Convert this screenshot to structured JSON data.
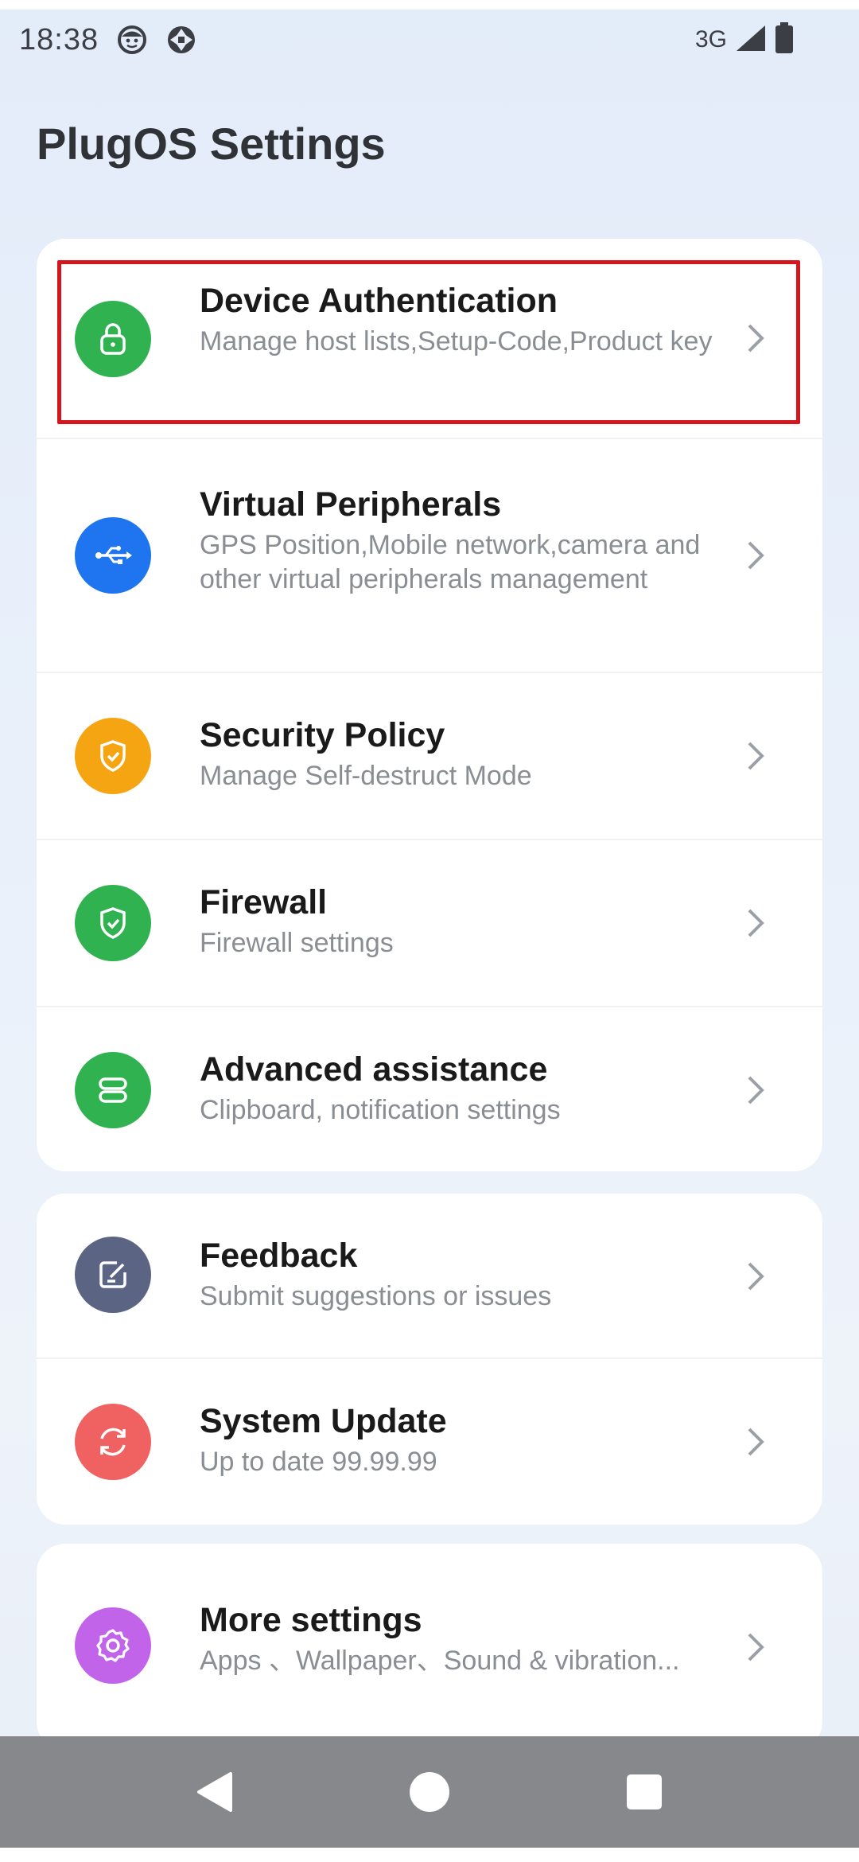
{
  "status_bar": {
    "time": "18:38",
    "network": "3G",
    "icons": [
      "face-notification-icon",
      "sync-notification-icon",
      "signal-icon",
      "battery-icon"
    ]
  },
  "page": {
    "title": "PlugOS Settings"
  },
  "groups": [
    {
      "items": [
        {
          "title": "Device Authentication",
          "subtitle": "Manage host lists,Setup-Code,Product key",
          "icon": "lock-icon",
          "color": "#2fb24f",
          "highlighted": true
        },
        {
          "title": "Virtual Peripherals",
          "subtitle": "GPS Position,Mobile network,camera and other virtual peripherals management",
          "icon": "usb-icon",
          "color": "#1f74f0"
        },
        {
          "title": "Security Policy",
          "subtitle": "Manage Self-destruct Mode",
          "icon": "shield-icon",
          "color": "#f6a512"
        },
        {
          "title": "Firewall",
          "subtitle": "Firewall settings",
          "icon": "shield-check-icon",
          "color": "#2fb24f"
        },
        {
          "title": "Advanced assistance",
          "subtitle": "Clipboard, notification settings",
          "icon": "toggles-icon",
          "color": "#2fb24f"
        }
      ]
    },
    {
      "items": [
        {
          "title": "Feedback",
          "subtitle": "Submit suggestions or issues",
          "icon": "edit-icon",
          "color": "#5b6482"
        },
        {
          "title": "System Update",
          "subtitle": "Up to date 99.99.99",
          "icon": "refresh-icon",
          "color": "#f06262"
        }
      ]
    },
    {
      "items": [
        {
          "title": "More settings",
          "subtitle": "Apps 、Wallpaper、Sound & vibration...",
          "icon": "gear-icon",
          "color": "#c264ea"
        }
      ]
    }
  ],
  "nav_bar": {
    "buttons": [
      "back-icon",
      "home-icon",
      "recents-icon"
    ]
  }
}
